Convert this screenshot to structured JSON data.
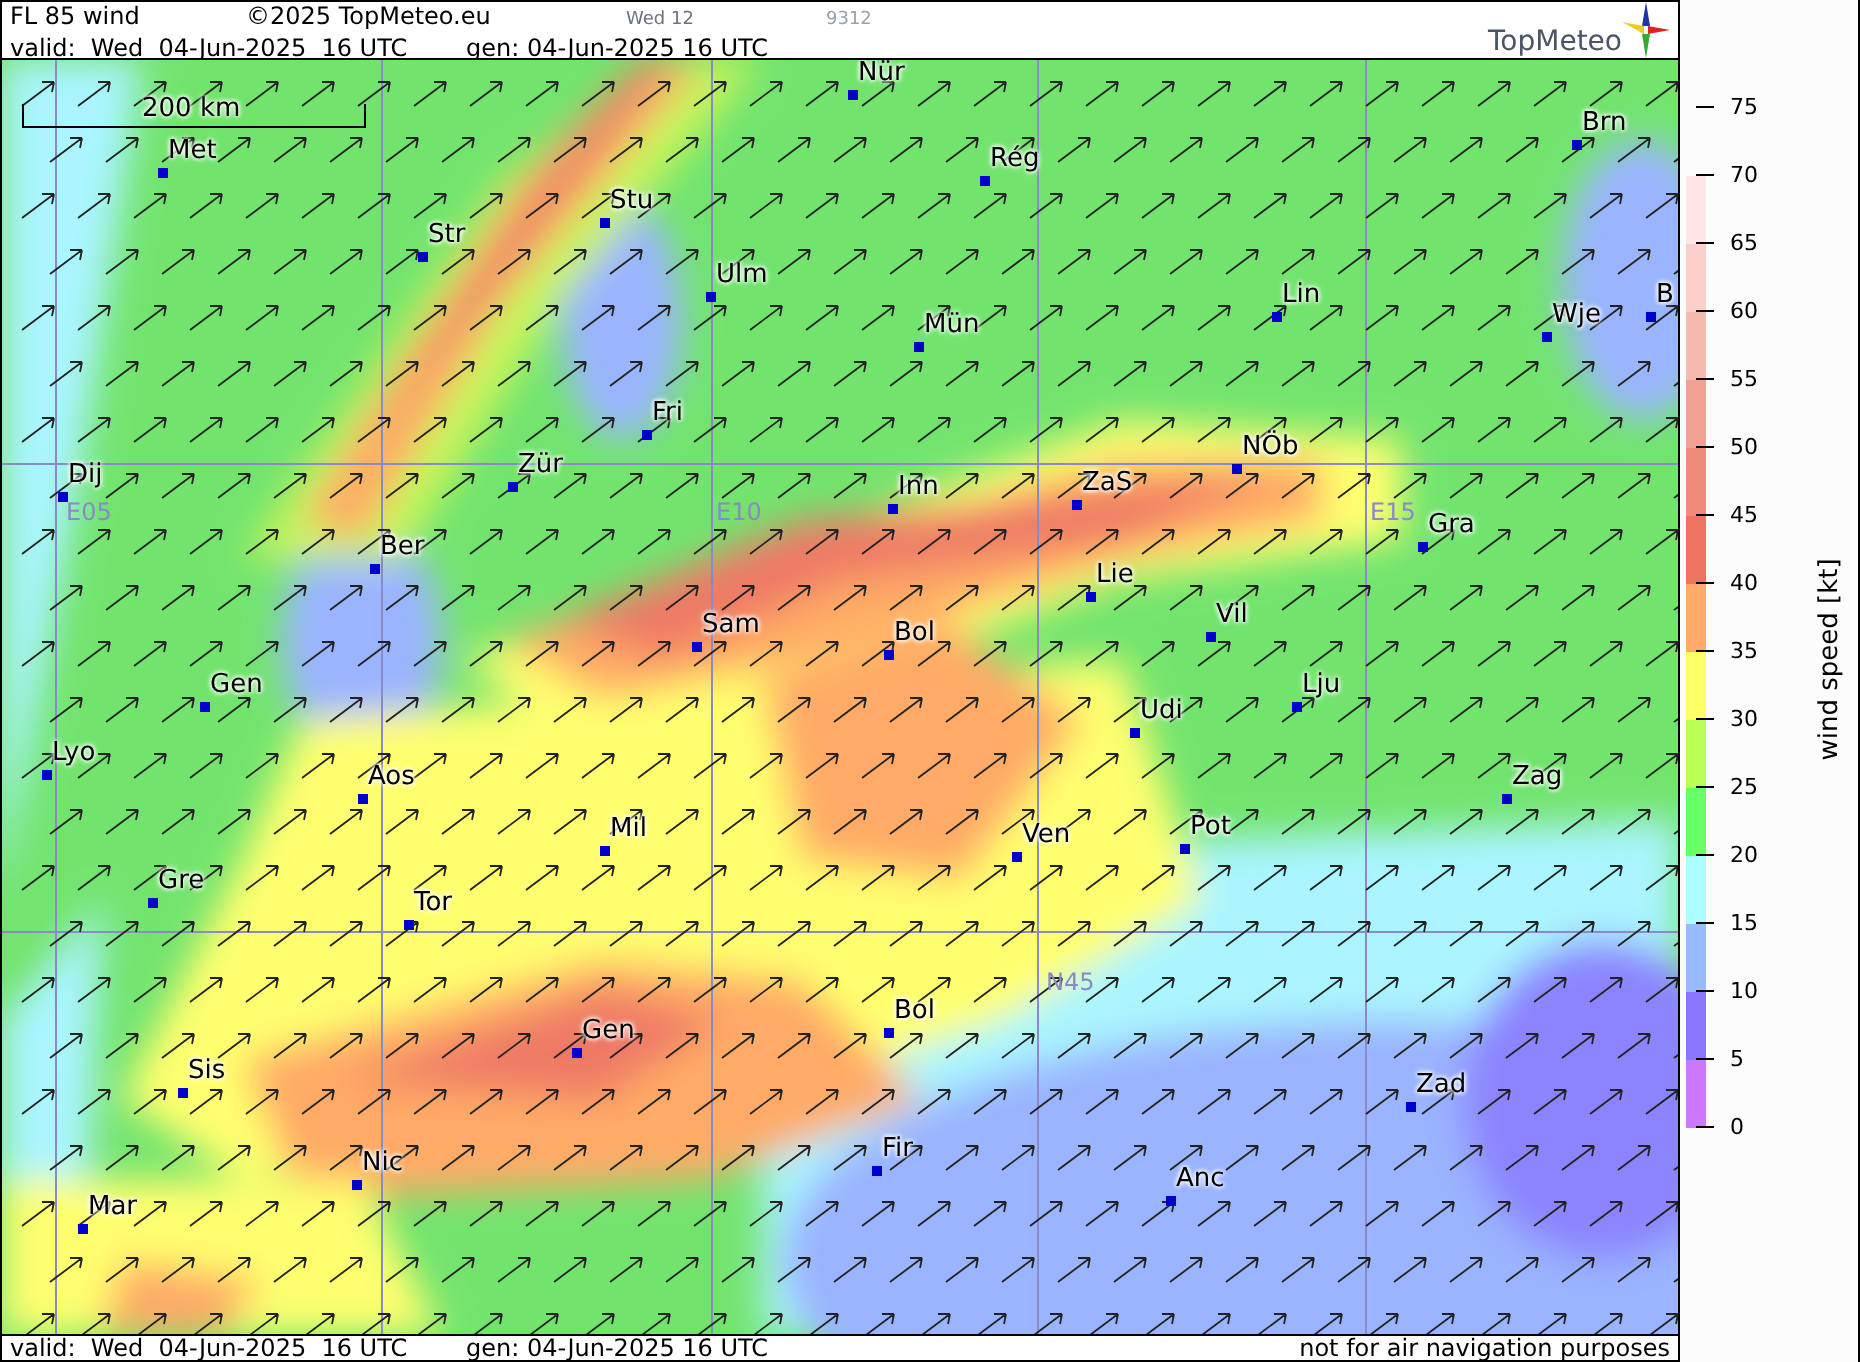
{
  "header": {
    "title": "FL 85 wind",
    "copyright": "©2025 TopMeteo.eu",
    "day_code": "Wed 12",
    "run_code": "9312",
    "valid": "valid:  Wed  04-Jun-2025  16 UTC",
    "generated": "gen: 04-Jun-2025 16 UTC",
    "logo": "TopMeteo"
  },
  "map": {
    "scale": "200 km",
    "grid_labels": [
      "E05",
      "E10",
      "E15",
      "N45"
    ],
    "cities": [
      "Nür",
      "Met",
      "Rég",
      "Brn",
      "Str",
      "Stu",
      "Ulm",
      "Lin",
      "Wje",
      "B",
      "Mün",
      "Fri",
      "Dij",
      "Zür",
      "Inn",
      "ZaS",
      "NÖb",
      "Gra",
      "Ber",
      "Lie",
      "Vil",
      "Sam",
      "Bol",
      "Lju",
      "Gen",
      "Udi",
      "Lyo",
      "Aos",
      "Zag",
      "Mil",
      "Ven",
      "Pot",
      "Gre",
      "Tor",
      "Bol",
      "Gen",
      "Sis",
      "Zad",
      "Nic",
      "Fir",
      "Anc",
      "Mar"
    ]
  },
  "legend": {
    "title": "wind speed [kt]",
    "ticks": [
      "75",
      "70",
      "65",
      "60",
      "55",
      "50",
      "45",
      "40",
      "35",
      "30",
      "25",
      "20",
      "15",
      "10",
      "5",
      "0"
    ],
    "bands": [
      {
        "color": "#ffe6e6"
      },
      {
        "color": "#fbd0cb"
      },
      {
        "color": "#f5b9b0"
      },
      {
        "color": "#f2a294"
      },
      {
        "color": "#ef8b7a"
      },
      {
        "color": "#ed7560"
      },
      {
        "color": "#ffaa66"
      },
      {
        "color": "#ffff66"
      },
      {
        "color": "#bbff55"
      },
      {
        "color": "#66ff66"
      },
      {
        "color": "#aaffff"
      },
      {
        "color": "#99bbff"
      },
      {
        "color": "#8877ff"
      },
      {
        "color": "#cc77ff"
      }
    ]
  },
  "footer": {
    "valid": "valid:  Wed  04-Jun-2025  16 UTC",
    "generated": "gen: 04-Jun-2025 16 UTC",
    "notice": "not for air navigation purposes"
  }
}
